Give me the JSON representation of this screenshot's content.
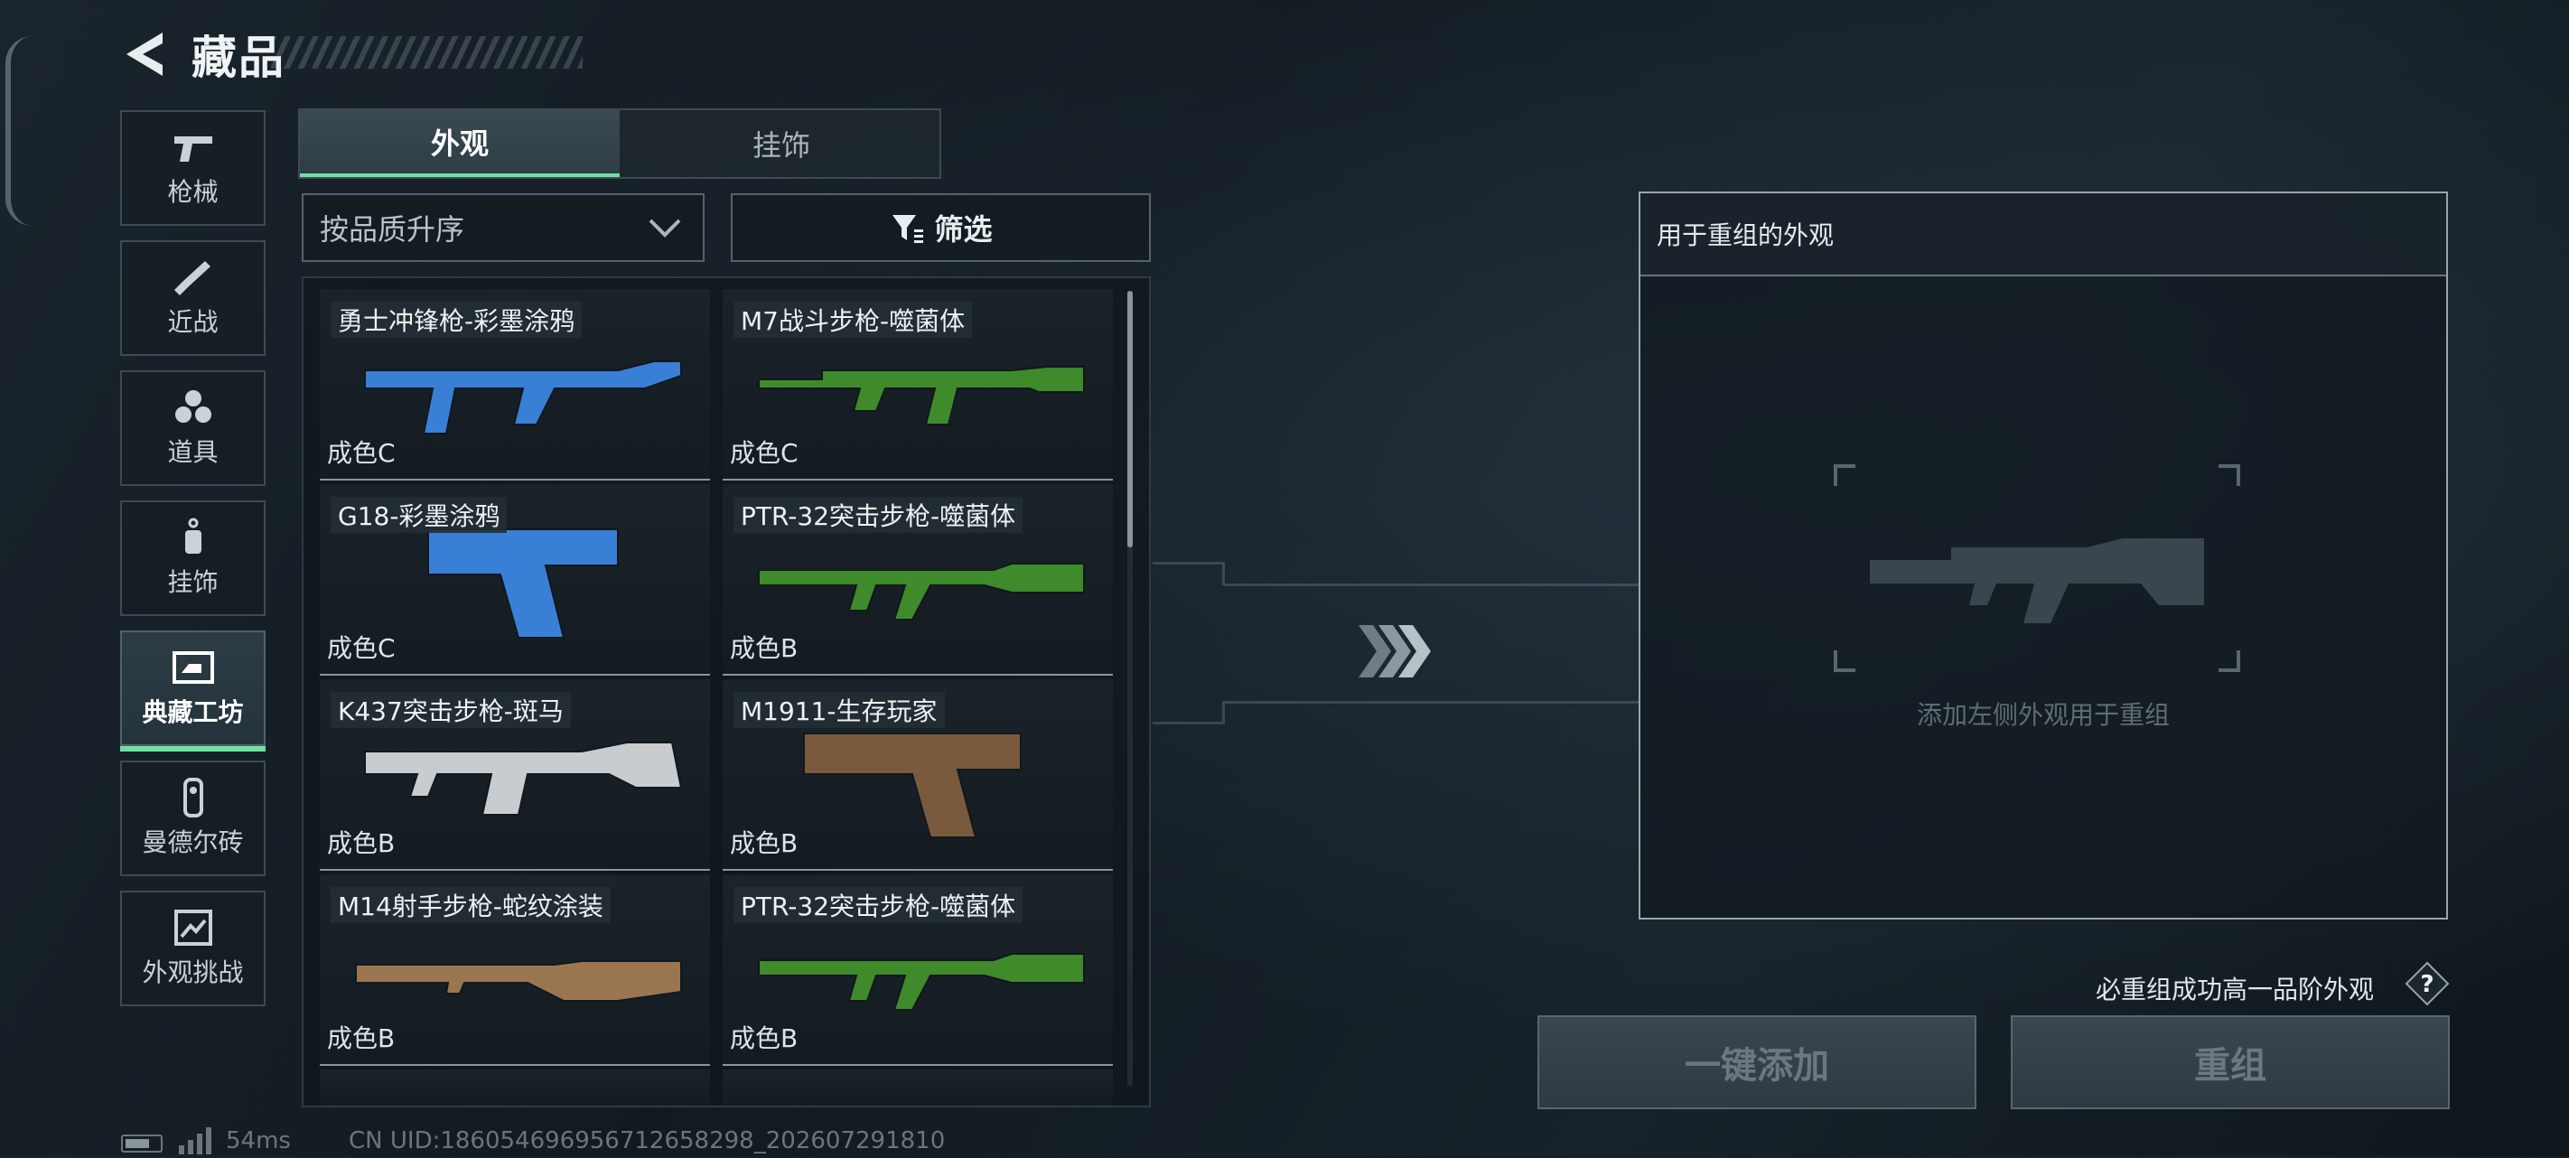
{
  "header": {
    "title": "藏品"
  },
  "sidebar": {
    "items": [
      {
        "label": "枪械",
        "icon": "pistol-icon"
      },
      {
        "label": "近战",
        "icon": "knife-icon"
      },
      {
        "label": "道具",
        "icon": "grenade-icon"
      },
      {
        "label": "挂饰",
        "icon": "charm-icon"
      },
      {
        "label": "典藏工坊",
        "icon": "workshop-icon",
        "active": true
      },
      {
        "label": "曼德尔砖",
        "icon": "brick-icon"
      },
      {
        "label": "外观挑战",
        "icon": "challenge-icon"
      }
    ]
  },
  "tabs": [
    {
      "label": "外观",
      "active": true
    },
    {
      "label": "挂饰",
      "active": false
    }
  ],
  "sort": {
    "value": "按品质升序"
  },
  "filter": {
    "label": "筛选"
  },
  "items": [
    {
      "name": "勇士冲锋枪-彩墨涂鸦",
      "grade": "成色C",
      "color": "#3a7fd6"
    },
    {
      "name": "M7战斗步枪-噬菌体",
      "grade": "成色C",
      "color": "#3f8a2a"
    },
    {
      "name": "G18-彩墨涂鸦",
      "grade": "成色C",
      "color": "#3a7fd6"
    },
    {
      "name": "PTR-32突击步枪-噬菌体",
      "grade": "成色B",
      "color": "#3f8a2a"
    },
    {
      "name": "K437突击步枪-斑马",
      "grade": "成色B",
      "color": "#c8cccf"
    },
    {
      "name": "M1911-生存玩家",
      "grade": "成色B",
      "color": "#7a5a3c"
    },
    {
      "name": "M14射手步枪-蛇纹涂装",
      "grade": "成色B",
      "color": "#9a7650"
    },
    {
      "name": "PTR-32突击步枪-噬菌体",
      "grade": "成色B",
      "color": "#3f8a2a"
    }
  ],
  "panel": {
    "title": "用于重组的外观",
    "hint": "添加左侧外观用于重组"
  },
  "guarantee_text": "必重组成功高一品阶外观",
  "buttons": {
    "quick_add": "一键添加",
    "recombine": "重组"
  },
  "status": {
    "ping": "54ms",
    "uid": "CN UID:186054696956712658298_202607291810"
  }
}
